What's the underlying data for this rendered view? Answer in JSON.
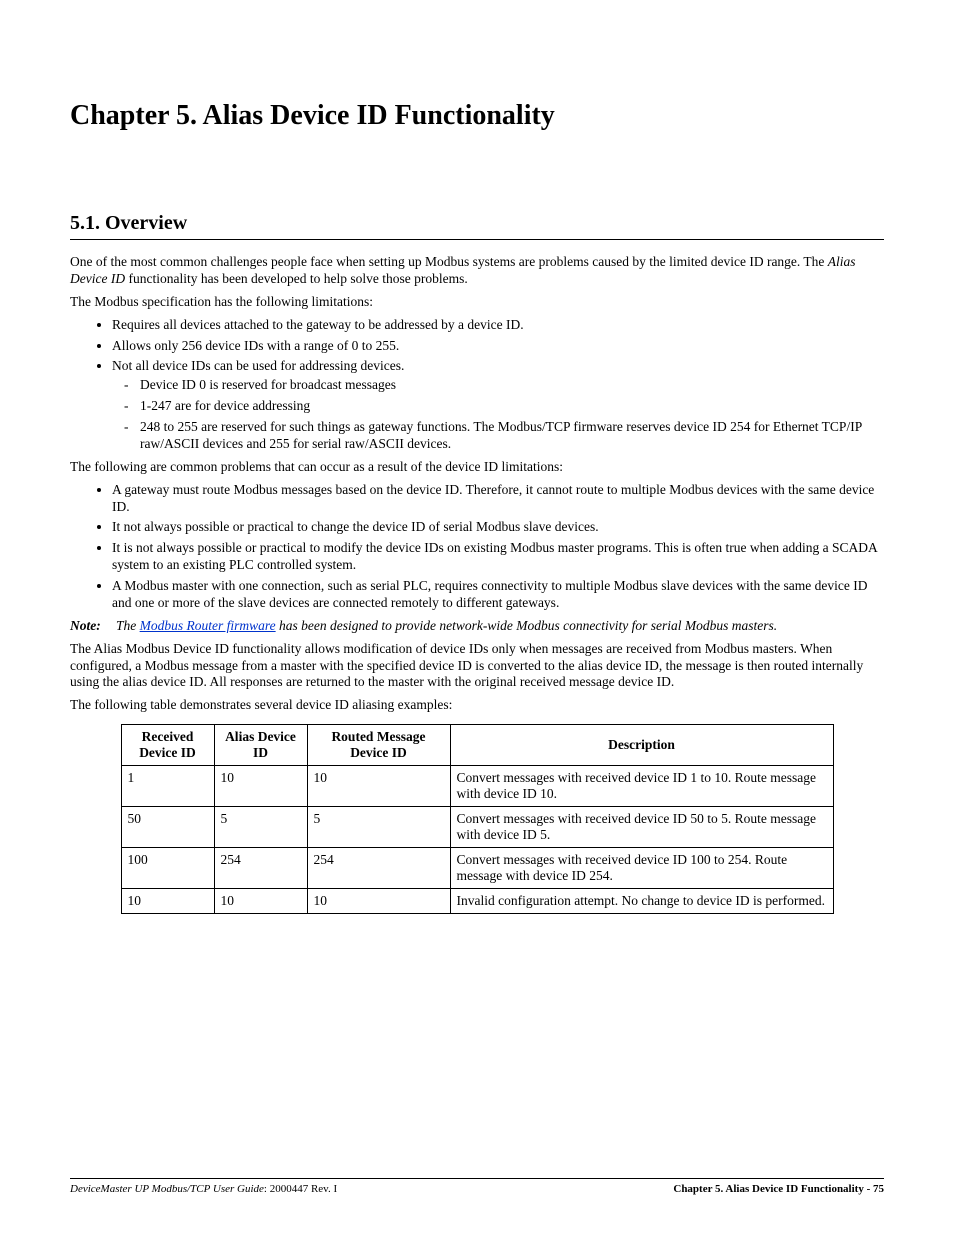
{
  "chapter_title": "Chapter 5.  Alias Device ID Functionality",
  "section_title": "5.1. Overview",
  "p1_a": "One of the most common challenges people face when setting up Modbus systems are problems caused by the limited device ID range. The ",
  "p1_italic": "Alias Device ID",
  "p1_b": " functionality has been developed to help solve those problems.",
  "p2": "The Modbus specification has the following limitations:",
  "list1": {
    "i1": "Requires all devices attached to the gateway to be addressed by a device ID.",
    "i2": "Allows only 256 device IDs with a range of 0 to 255.",
    "i3": "Not all device IDs can be used for addressing devices.",
    "i3_sub": {
      "a": "Device ID 0 is reserved for broadcast messages",
      "b": "1-247 are for device addressing",
      "c": "248 to 255 are reserved for such things as gateway functions. The Modbus/TCP firmware reserves device ID 254 for Ethernet TCP/IP raw/ASCII devices and 255 for serial raw/ASCII devices."
    }
  },
  "p3": "The following are common problems that can occur as a result of the device ID limitations:",
  "list2": {
    "i1": "A gateway must route Modbus messages based on the device ID. Therefore, it cannot route to multiple Modbus devices with the same device ID.",
    "i2": "It not always possible or practical to change the device ID of serial Modbus slave devices.",
    "i3": "It is not always possible or practical to modify the device IDs on existing Modbus master programs. This is often true when adding a SCADA system to an existing PLC controlled system.",
    "i4": "A Modbus master with one connection, such as serial PLC, requires connectivity to multiple Modbus slave devices with the same device ID and one or more of the slave devices are connected remotely to different gateways."
  },
  "note_label": "Note:",
  "note_a": "The ",
  "note_link": "Modbus Router firmware",
  "note_b": " has been designed to provide network-wide Modbus connectivity for serial Modbus masters.",
  "p4": "The Alias Modbus Device ID functionality allows modification of device IDs only when messages are received from Modbus masters. When configured, a Modbus message from a master with the specified device ID is converted to the alias device ID, the message is then routed internally using the alias device ID. All responses are returned to the master with the original received message device ID.",
  "p5": "The following table demonstrates several device ID aliasing examples:",
  "table": {
    "headers": {
      "received": "Received Device ID",
      "alias": "Alias Device ID",
      "routed": "Routed Message Device ID",
      "desc": "Description"
    },
    "rows": [
      {
        "received": "1",
        "alias": "10",
        "routed": "10",
        "desc": "Convert messages with received device ID 1 to 10. Route message with device ID 10."
      },
      {
        "received": "50",
        "alias": "5",
        "routed": "5",
        "desc": "Convert messages with received device ID 50 to 5. Route message with device ID 5."
      },
      {
        "received": "100",
        "alias": "254",
        "routed": "254",
        "desc": "Convert messages with received device ID 100 to 254. Route message with device ID 254."
      },
      {
        "received": "10",
        "alias": "10",
        "routed": "10",
        "desc": "Invalid configuration attempt. No change to device ID is performed."
      }
    ]
  },
  "footer": {
    "left_italic": "DeviceMaster UP Modbus/TCP User Guide",
    "left_rest": ": 2000447 Rev. I",
    "right": "Chapter 5. Alias Device ID Functionality - 75"
  }
}
